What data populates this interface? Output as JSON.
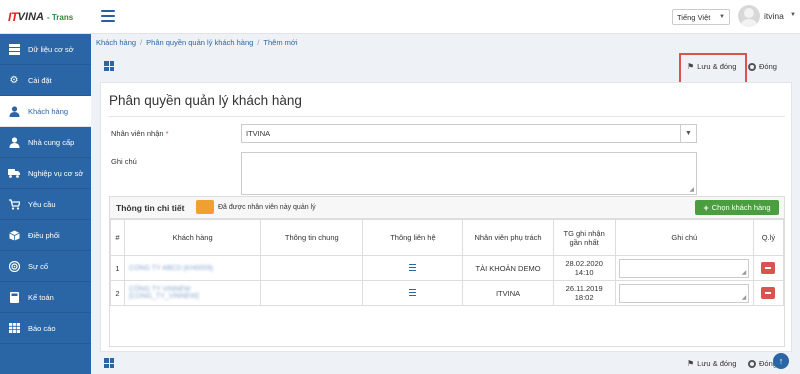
{
  "header": {
    "logo_it": "IT",
    "logo_vina": "VINA",
    "logo_suffix": "- Trans",
    "language": "Tiếng Việt",
    "username": "itvina"
  },
  "sidebar": {
    "items": [
      {
        "label": "Dữ liệu cơ sở",
        "icon": "layers-icon"
      },
      {
        "label": "Cài đặt",
        "icon": "gear-icon"
      },
      {
        "label": "Khách hàng",
        "icon": "user-icon",
        "active": true
      },
      {
        "label": "Nhà cung cấp",
        "icon": "user-icon"
      },
      {
        "label": "Nghiệp vụ cơ sở",
        "icon": "truck-icon"
      },
      {
        "label": "Yêu cầu",
        "icon": "cart-icon"
      },
      {
        "label": "Điều phối",
        "icon": "cube-icon"
      },
      {
        "label": "Sự cố",
        "icon": "target-icon"
      },
      {
        "label": "Kế toán",
        "icon": "calculator-icon"
      },
      {
        "label": "Báo cáo",
        "icon": "table-icon"
      }
    ]
  },
  "breadcrumb": [
    "Khách hàng",
    "Phân quyền quản lý khách hàng",
    "Thêm mới"
  ],
  "toolbar": {
    "save_label": "Lưu & đóng",
    "close_label": "Đóng"
  },
  "form": {
    "title": "Phân quyền quản lý khách hàng",
    "staff_label": "Nhân viên nhận",
    "staff_required": "*",
    "staff_value": "ITVINA",
    "note_label": "Ghi chú",
    "note_value": ""
  },
  "detail": {
    "title": "Thông tin chi tiết",
    "legend": "Đã được nhân viên này quản lý",
    "legend_color": "#f0a030",
    "add_label": "Chọn khách hàng",
    "columns": [
      "#",
      "Khách hàng",
      "Thông tin chung",
      "Thông liên hệ",
      "Nhân viên phụ trách",
      "TG ghi nhận gần nhất",
      "Ghi chú",
      "Q.lý"
    ],
    "rows": [
      {
        "no": "1",
        "customer": "CONG TY ABCD [KH0009]",
        "general": "",
        "staff": "TÀI KHOẢN DEMO",
        "date": "28.02.2020",
        "time": "14:10",
        "note": ""
      },
      {
        "no": "2",
        "customer": "CÔNG TY VINNEW [CONG_TY_VINNEW]",
        "general": "",
        "staff": "ITVINA",
        "date": "26.11.2019",
        "time": "18:02",
        "note": ""
      }
    ]
  },
  "colors": {
    "primary": "#2a66a6",
    "danger": "#d9534f",
    "success": "#4a9e3f"
  }
}
